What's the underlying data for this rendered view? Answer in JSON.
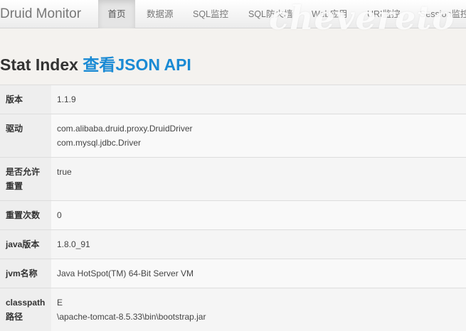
{
  "navbar": {
    "brand": "Druid Monitor",
    "items": [
      "首页",
      "数据源",
      "SQL监控",
      "SQL防火墙",
      "Web应用",
      "URI监控",
      "Session监控"
    ],
    "active_index": 0
  },
  "watermark": "chevereto",
  "page": {
    "title": "Stat Index",
    "link": "查看JSON API"
  },
  "rows": [
    {
      "key": "版本",
      "values": [
        "1.1.9"
      ]
    },
    {
      "key": "驱动",
      "values": [
        "com.alibaba.druid.proxy.DruidDriver",
        "com.mysql.jdbc.Driver"
      ]
    },
    {
      "key": "是否允许重置",
      "values": [
        "true"
      ]
    },
    {
      "key": "重置次数",
      "values": [
        "0"
      ]
    },
    {
      "key": "java版本",
      "values": [
        "1.8.0_91"
      ]
    },
    {
      "key": "jvm名称",
      "values": [
        "Java HotSpot(TM) 64-Bit Server VM"
      ]
    },
    {
      "key": "classpath路径",
      "values": [
        "E",
        "\\apache-tomcat-8.5.33\\bin\\bootstrap.jar"
      ]
    }
  ]
}
